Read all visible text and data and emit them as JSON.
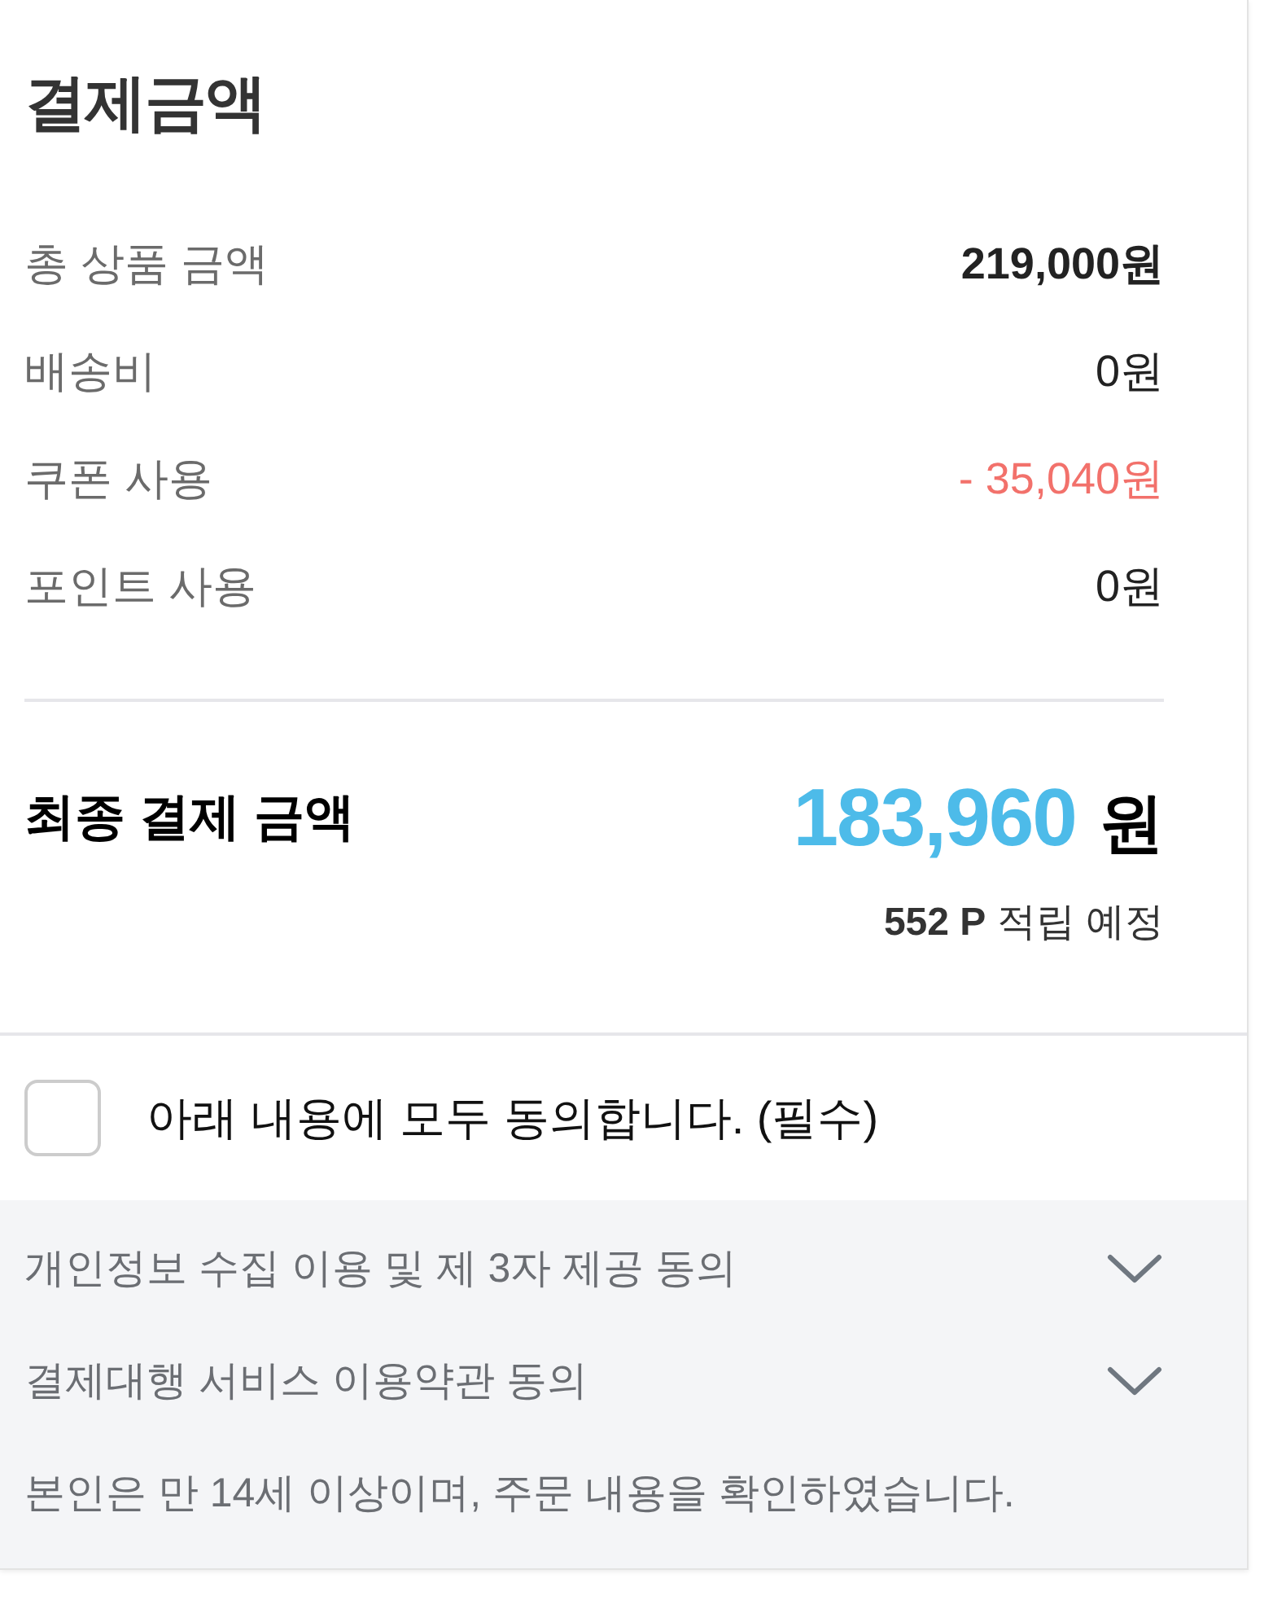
{
  "title": "결제금액",
  "summary_rows": [
    {
      "label": "총 상품 금액",
      "value": "219,000원",
      "kind": "total"
    },
    {
      "label": "배송비",
      "value": "0원",
      "kind": "plain"
    },
    {
      "label": "쿠폰 사용",
      "value": "- 35,040원",
      "kind": "discount"
    },
    {
      "label": "포인트 사용",
      "value": "0원",
      "kind": "plain"
    }
  ],
  "final": {
    "label": "최종 결제 금액",
    "amount": "183,960",
    "unit": "원",
    "points": "**552 P** 적립 예정"
  },
  "agree_all": {
    "label": "아래 내용에 모두 동의합니다. (필수)",
    "checked": false
  },
  "terms": [
    {
      "label": "개인정보 수집 이용 및 제 3자 제공 동의",
      "kind": "expandable",
      "expanded": false
    },
    {
      "label": "결제대행 서비스 이용약관 동의",
      "kind": "expandable",
      "expanded": false
    },
    {
      "label": "본인은 만 14세 이상이며, 주문 내용을 확인하였습니다.",
      "kind": "note"
    }
  ]
}
